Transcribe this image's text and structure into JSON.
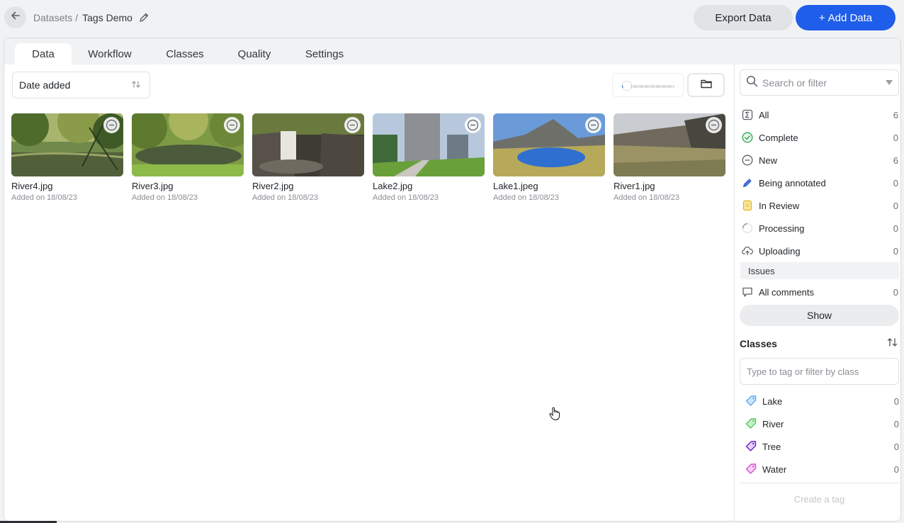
{
  "header": {
    "back_icon": "arrow-left-icon",
    "breadcrumb_parent": "Datasets",
    "breadcrumb_separator": "/",
    "breadcrumb_current": "Tags Demo",
    "edit_icon": "pencil-icon",
    "export_label": "Export Data",
    "add_label": "Add Data",
    "add_prefix": "+"
  },
  "tabs": [
    {
      "label": "Data",
      "active": true
    },
    {
      "label": "Workflow",
      "active": false
    },
    {
      "label": "Classes",
      "active": false
    },
    {
      "label": "Quality",
      "active": false
    },
    {
      "label": "Settings",
      "active": false
    }
  ],
  "toolbar": {
    "sort_value": "Date added",
    "sort_icon": "sort-arrows-icon",
    "zoom_level": 0.1,
    "folder_icon": "folder-icon"
  },
  "files": [
    {
      "name": "River4.jpg",
      "date": "Added on 18/08/23",
      "status_icon": "minus-circle-icon"
    },
    {
      "name": "River3.jpg",
      "date": "Added on 18/08/23",
      "status_icon": "minus-circle-icon"
    },
    {
      "name": "River2.jpg",
      "date": "Added on 18/08/23",
      "status_icon": "minus-circle-icon"
    },
    {
      "name": "Lake2.jpg",
      "date": "Added on 18/08/23",
      "status_icon": "minus-circle-icon"
    },
    {
      "name": "Lake1.jpeg",
      "date": "Added on 18/08/23",
      "status_icon": "minus-circle-icon"
    },
    {
      "name": "River1.jpg",
      "date": "Added on 18/08/23",
      "status_icon": "minus-circle-icon"
    }
  ],
  "sidebar": {
    "search_placeholder": "Search or filter",
    "statuses": [
      {
        "label": "All",
        "count": "6",
        "icon": "sigma-box-icon"
      },
      {
        "label": "Complete",
        "count": "0",
        "icon": "check-circle-icon"
      },
      {
        "label": "New",
        "count": "6",
        "icon": "minus-circle-icon"
      },
      {
        "label": "Being annotated",
        "count": "0",
        "icon": "pen-icon"
      },
      {
        "label": "In Review",
        "count": "0",
        "icon": "review-note-icon"
      },
      {
        "label": "Processing",
        "count": "0",
        "icon": "spinner-icon"
      },
      {
        "label": "Uploading",
        "count": "0",
        "icon": "cloud-upload-icon"
      }
    ],
    "issues_label": "Issues",
    "comments": {
      "label": "All comments",
      "count": "0",
      "icon": "comment-icon"
    },
    "show_label": "Show",
    "classes_label": "Classes",
    "classes_sort_icon": "sort-arrows-icon",
    "class_input_placeholder": "Type to tag or filter by class",
    "classes": [
      {
        "label": "Lake",
        "count": "0",
        "color": "#5aa9f0",
        "fill": "#cfe6fb",
        "icon": "tag-icon"
      },
      {
        "label": "River",
        "count": "0",
        "color": "#4fc85a",
        "fill": "#c9f1c8",
        "icon": "tag-icon"
      },
      {
        "label": "Tree",
        "count": "0",
        "color": "#6a1fd1",
        "fill": "#e2d2fa",
        "icon": "tag-icon"
      },
      {
        "label": "Water",
        "count": "0",
        "color": "#d54fd1",
        "fill": "#f6d0f4",
        "icon": "tag-icon"
      }
    ],
    "create_tag_label": "Create a tag"
  },
  "colors": {
    "primary": "#1f5eea",
    "complete": "#2ea84b",
    "review": "#e6b317"
  }
}
